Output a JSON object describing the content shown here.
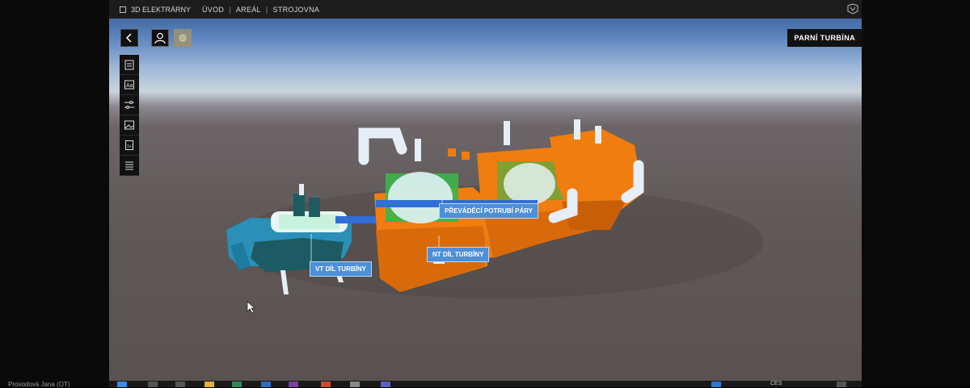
{
  "app": {
    "brand": "3D ELEKTRÁRNY",
    "nav": [
      "ÚVOD",
      "AREÁL",
      "STROJOVNA"
    ],
    "title_badge": "PARNÍ TURBÍNA"
  },
  "toolbar": {
    "icons": [
      "clipboard-icon",
      "text-image-icon",
      "sliders-icon",
      "image-icon",
      "calculator-icon",
      "list-icon"
    ]
  },
  "scene_labels": {
    "vt": "VT DÍL TURBÍNY",
    "nt": "NT DÍL TURBÍNY",
    "pp": "PŘEVÁDĚCÍ POTRUBÍ PÁRY"
  },
  "presenter": "Provodová Jana (OT)",
  "taskbar": {
    "language": "CES"
  },
  "colors": {
    "casing": "#f07d10",
    "hp_casing": "#2b8fb8",
    "pipes": "#e6eef7",
    "rotor": "#2f6fd6",
    "label_bg": "#4d8fd8",
    "ui_dark": "#111111"
  }
}
